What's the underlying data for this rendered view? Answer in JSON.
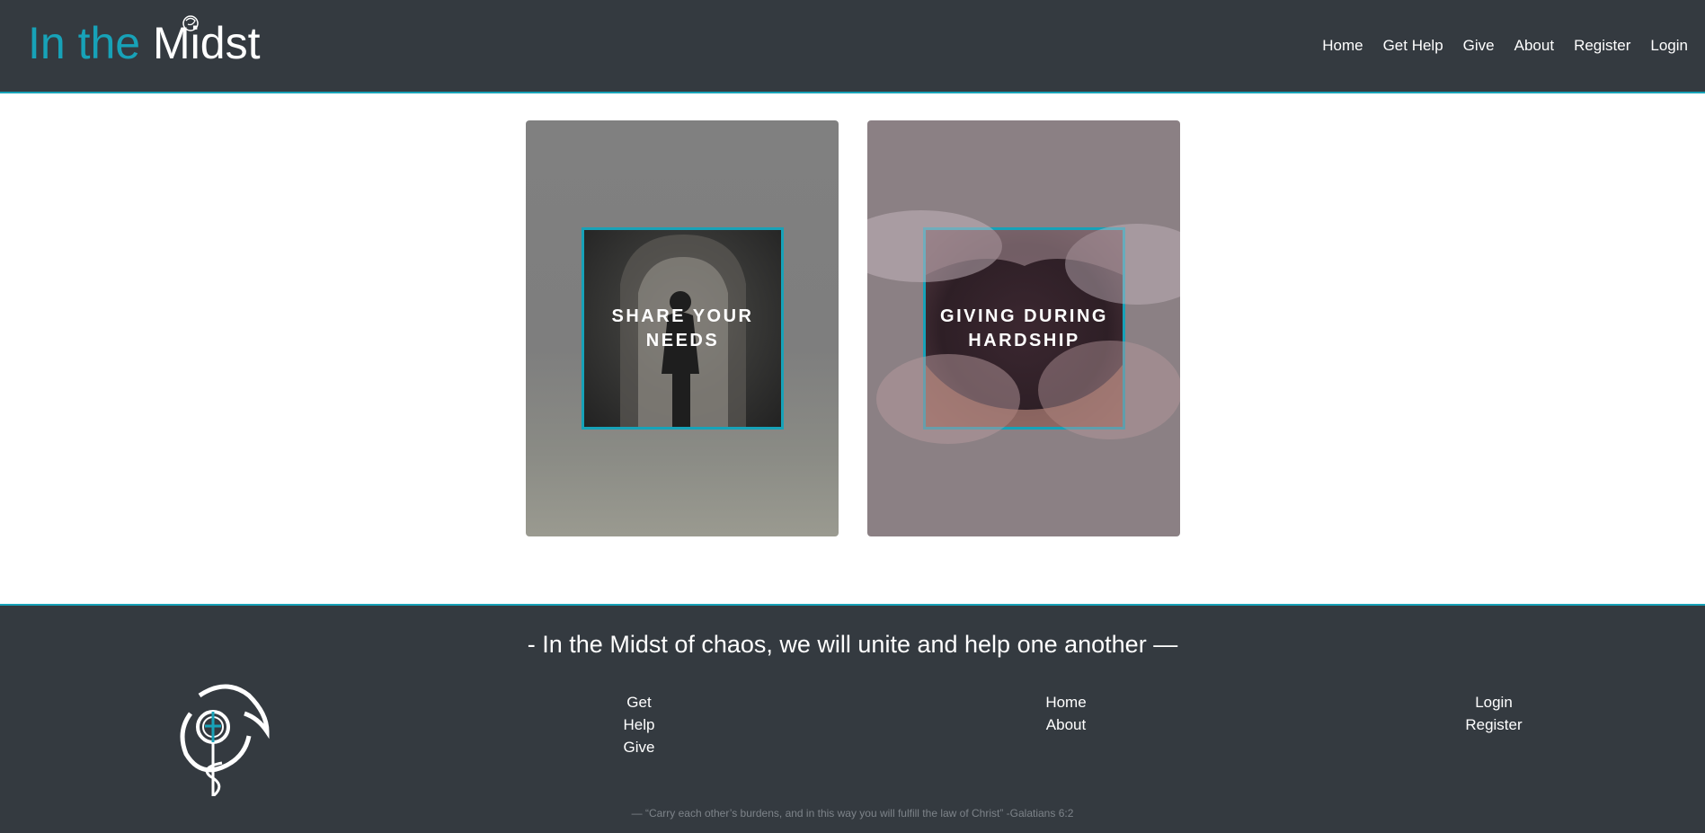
{
  "header": {
    "logo_part1": "In the ",
    "logo_part2": "Midst",
    "nav": [
      "Home",
      "Get Help",
      "Give",
      "About",
      "Register",
      "Login"
    ]
  },
  "cards": [
    {
      "title_line1": "SHARE YOUR",
      "title_line2": "NEEDS"
    },
    {
      "title_line1": "GIVING DURING",
      "title_line2": "HARDSHIP"
    }
  ],
  "footer": {
    "tagline": "- In the Midst of chaos, we will unite and help one another —",
    "col1": [
      "Get Help",
      "Give"
    ],
    "col2": [
      "Home",
      "About"
    ],
    "col3": [
      "Login",
      "Register"
    ],
    "verse": "— “Carry each other’s burdens, and in this way you will fulfill the law of Christ” -Galatians 6:2"
  },
  "colors": {
    "accent": "#17a2b8",
    "bar": "#343a40"
  }
}
